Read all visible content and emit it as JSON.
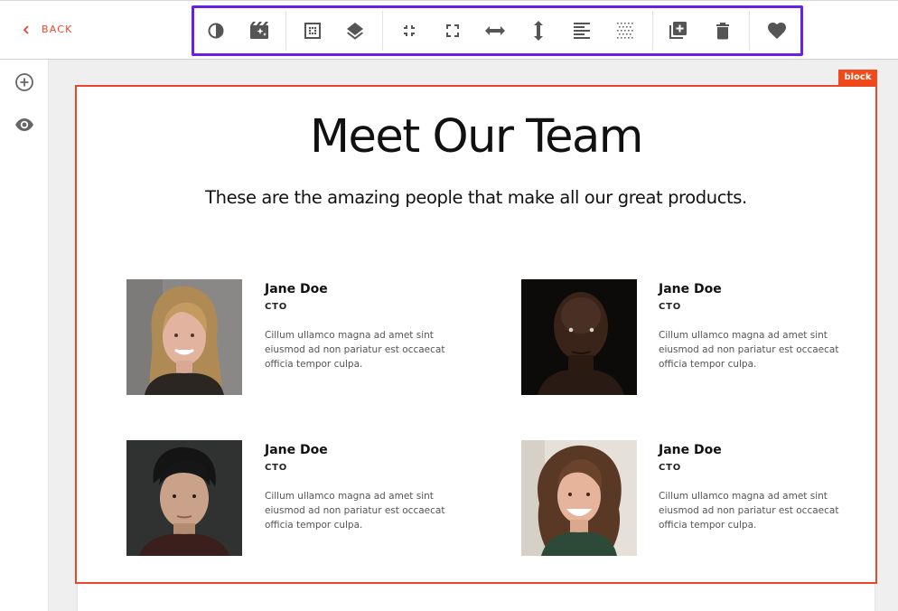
{
  "topbar": {
    "back_label": "BACK",
    "accent_color": "#e8472c",
    "toolbar_outline_color": "#6a1fe6",
    "toolbar_icons": [
      "contrast-icon",
      "movie-magic-icon",
      "grid-dots-icon",
      "layers-icon",
      "fullscreen-exit-icon",
      "fullscreen-icon",
      "width-arrows-icon",
      "height-arrows-icon",
      "align-left-icon",
      "pattern-icon",
      "duplicate-icon",
      "delete-icon",
      "favorite-icon"
    ]
  },
  "leftbar": {
    "icons": [
      "add-circle-icon",
      "eye-icon"
    ]
  },
  "block": {
    "tag": "block"
  },
  "section": {
    "title": "Meet Our Team",
    "subtitle": "These are the amazing people that make all our great products."
  },
  "members": [
    {
      "name": "Jane Doe",
      "role": "CTO",
      "bio": "Cillum ullamco magna ad amet sint eiusmod ad non pariatur est occaecat officia tempor culpa."
    },
    {
      "name": "Jane Doe",
      "role": "CTO",
      "bio": "Cillum ullamco magna ad amet sint eiusmod ad non pariatur est occaecat officia tempor culpa."
    },
    {
      "name": "Jane Doe",
      "role": "CTO",
      "bio": "Cillum ullamco magna ad amet sint eiusmod ad non pariatur est occaecat officia tempor culpa."
    },
    {
      "name": "Jane Doe",
      "role": "CTO",
      "bio": "Cillum ullamco magna ad amet sint eiusmod ad non pariatur est occaecat officia tempor culpa."
    }
  ]
}
